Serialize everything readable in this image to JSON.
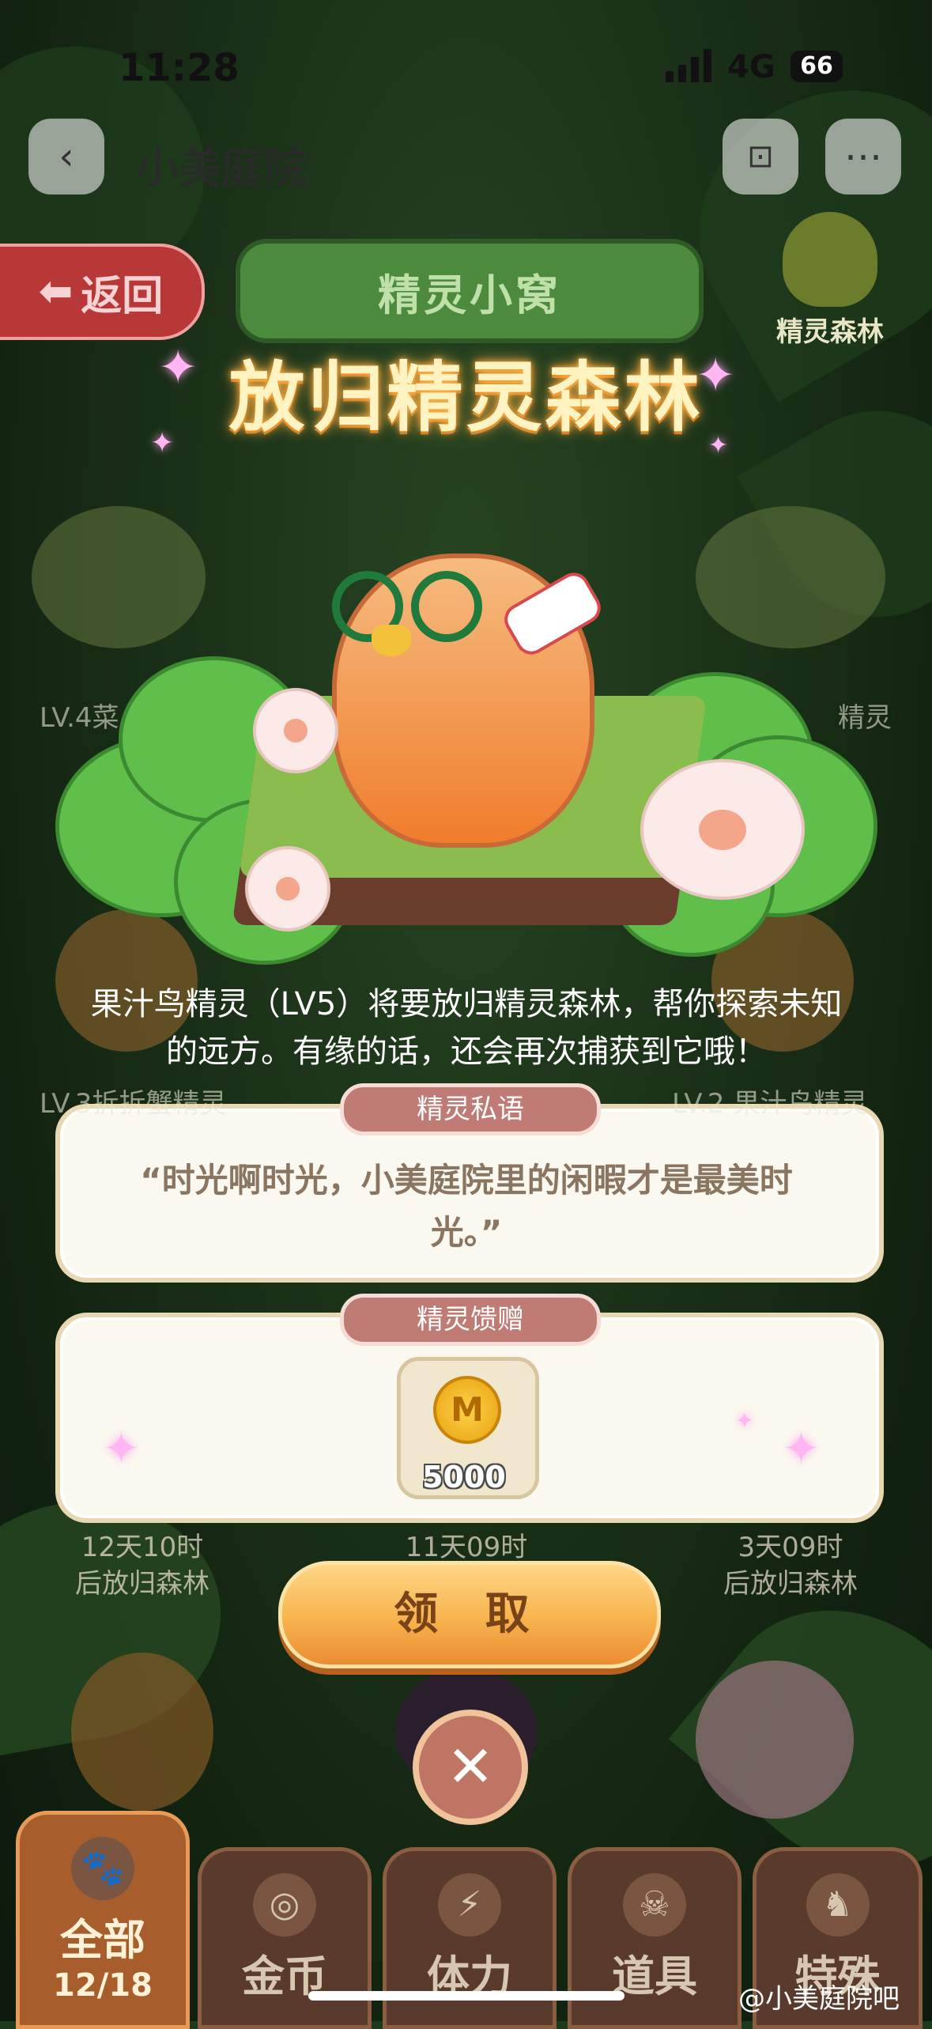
{
  "status_bar": {
    "time": "11:28",
    "network": "4G",
    "battery": "66"
  },
  "nav": {
    "title": "小美庭院"
  },
  "header": {
    "back_label": "返回",
    "plaque_title": "精灵小窝",
    "forest_label": "精灵森林"
  },
  "dialog": {
    "title": "放归精灵森林",
    "description": "果汁鸟精灵（LV5）将要放归精灵森林，帮你探索未知的远方。有缘的话，还会再次捕获到它哦！",
    "whisper_tag": "精灵私语",
    "whisper_text": "“时光啊时光，小美庭院里的闲暇才是最美时光。”",
    "gift_tag": "精灵馈赠",
    "gift_coin_symbol": "M",
    "gift_amount": "5000",
    "claim_label": "领 取",
    "close_symbol": "✕"
  },
  "background_list": {
    "levels": [
      "LV.4菜",
      "精灵",
      "LV.3拆拆蟹精灵",
      "LV.2 果汁鸟精灵"
    ],
    "timers": [
      {
        "line1": "12天10时",
        "line2": "后放归森林"
      },
      {
        "line1": "11天09时",
        "line2": ""
      },
      {
        "line1": "3天09时",
        "line2": "后放归森林"
      }
    ]
  },
  "tabs": [
    {
      "label": "全部",
      "count": "12/18",
      "icon": "paw-icon"
    },
    {
      "label": "金币",
      "icon": "coin-stack-icon"
    },
    {
      "label": "体力",
      "icon": "lightning-icon"
    },
    {
      "label": "道具",
      "icon": "skull-icon"
    },
    {
      "label": "特殊",
      "icon": "rabbit-icon"
    }
  ],
  "watermark": "@小美庭院吧"
}
